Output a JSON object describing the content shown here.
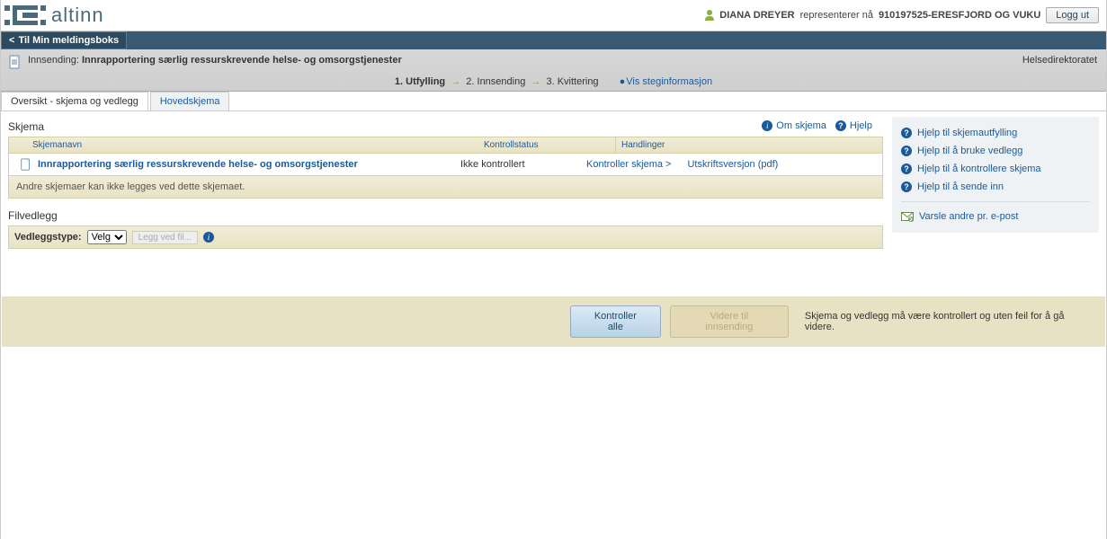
{
  "header": {
    "brand": "altinn",
    "user_name": "DIANA DREYER",
    "rep_text": "representerer nå",
    "org": "910197525-ERESFJORD OG VUKU",
    "logout": "Logg ut"
  },
  "nav": {
    "back": "Til Min meldingsboks"
  },
  "infobar": {
    "label": "Innsending:",
    "title": "Innrapportering særlig ressurskrevende helse- og omsorgstjenester",
    "owner": "Helsedirektoratet",
    "steps": {
      "s1": "1.  Utfylling",
      "s2": "2.  Innsending",
      "s3": "3.  Kvittering",
      "info": "Vis steginformasjon"
    }
  },
  "tabs": {
    "overview": "Oversikt - skjema og vedlegg",
    "main": "Hovedskjema"
  },
  "toplinks": {
    "om": "Om skjema",
    "hjelp": "Hjelp"
  },
  "skjema": {
    "title": "Skjema",
    "cols": {
      "name": "Skjemanavn",
      "status": "Kontrollstatus",
      "actions": "Handlinger"
    },
    "row": {
      "name": "Innrapportering særlig ressurskrevende helse- og omsorgstjenester",
      "status": "Ikke kontrollert",
      "action_check": "Kontroller skjema  >",
      "action_print": "Utskriftsversjon (pdf)"
    },
    "footer_note": "Andre skjemaer kan ikke legges ved dette skjemaet."
  },
  "filvedlegg": {
    "title": "Filvedlegg",
    "type_label": "Vedleggstype:",
    "select_value": "Velg",
    "add_btn": "Legg ved fil..."
  },
  "side": {
    "help_fill": "Hjelp til skjemautfylling",
    "help_attach": "Hjelp til å bruke vedlegg",
    "help_check": "Hjelp til å kontrollere skjema",
    "help_send": "Hjelp til å sende inn",
    "notify": "Varsle andre pr. e-post"
  },
  "footer": {
    "check_all": "Kontroller alle",
    "next": "Videre til innsending",
    "note": "Skjema og vedlegg må være kontrollert og uten feil for å gå videre."
  }
}
